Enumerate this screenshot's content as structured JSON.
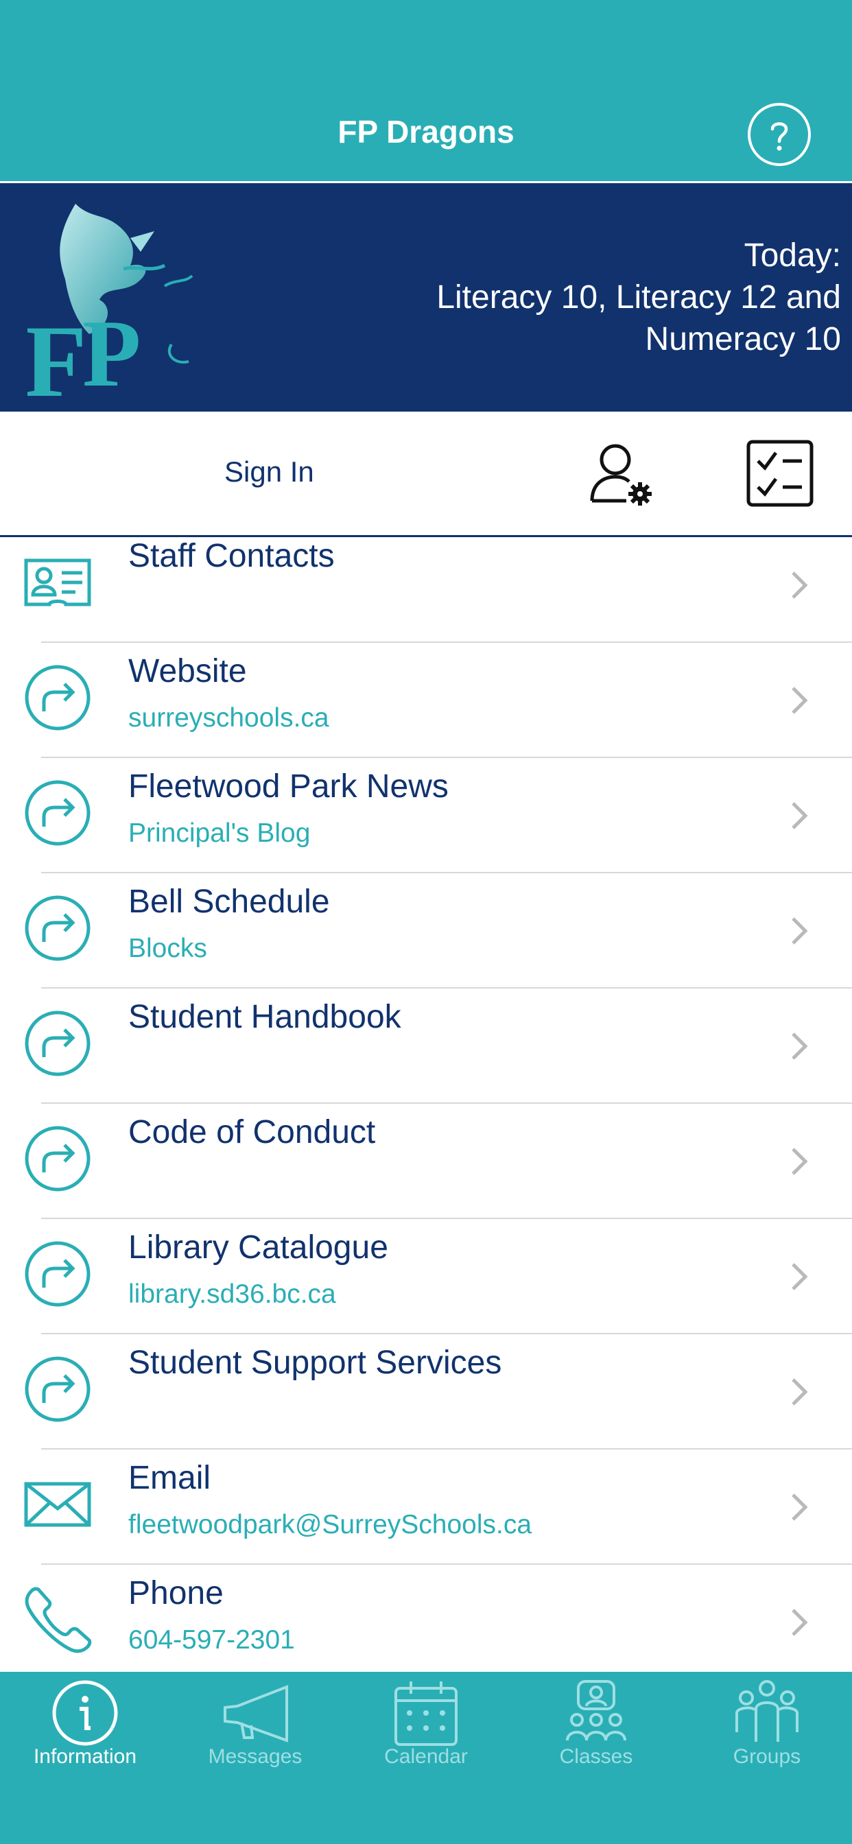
{
  "app": {
    "title": "FP Dragons"
  },
  "banner": {
    "today_label": "Today:",
    "today_line1": "Literacy 10, Literacy 12 and",
    "today_line2": "Numeracy 10"
  },
  "signbar": {
    "sign_in_label": "Sign In"
  },
  "list": [
    {
      "title": "Staff Contacts",
      "subtitle": "",
      "icon": "contact-card-icon"
    },
    {
      "title": "Website",
      "subtitle": "surreyschools.ca",
      "icon": "link-arrow-icon"
    },
    {
      "title": "Fleetwood Park News",
      "subtitle": "Principal's Blog",
      "icon": "link-arrow-icon"
    },
    {
      "title": "Bell Schedule",
      "subtitle": "Blocks",
      "icon": "link-arrow-icon"
    },
    {
      "title": "Student Handbook",
      "subtitle": "",
      "icon": "link-arrow-icon"
    },
    {
      "title": "Code of Conduct",
      "subtitle": "",
      "icon": "link-arrow-icon"
    },
    {
      "title": "Library Catalogue",
      "subtitle": "library.sd36.bc.ca",
      "icon": "link-arrow-icon"
    },
    {
      "title": "Student Support Services",
      "subtitle": "",
      "icon": "link-arrow-icon"
    },
    {
      "title": "Email",
      "subtitle": "fleetwoodpark@SurreySchools.ca",
      "icon": "envelope-icon"
    },
    {
      "title": "Phone",
      "subtitle": "604-597-2301",
      "icon": "phone-icon"
    }
  ],
  "tabs": [
    {
      "label": "Information",
      "icon": "info-icon",
      "active": true
    },
    {
      "label": "Messages",
      "icon": "megaphone-icon",
      "active": false
    },
    {
      "label": "Calendar",
      "icon": "calendar-icon",
      "active": false
    },
    {
      "label": "Classes",
      "icon": "classes-icon",
      "active": false
    },
    {
      "label": "Groups",
      "icon": "groups-icon",
      "active": false
    }
  ],
  "colors": {
    "teal": "#2aaeb5",
    "navy": "#11326d",
    "chevron": "#b9b9b9"
  }
}
